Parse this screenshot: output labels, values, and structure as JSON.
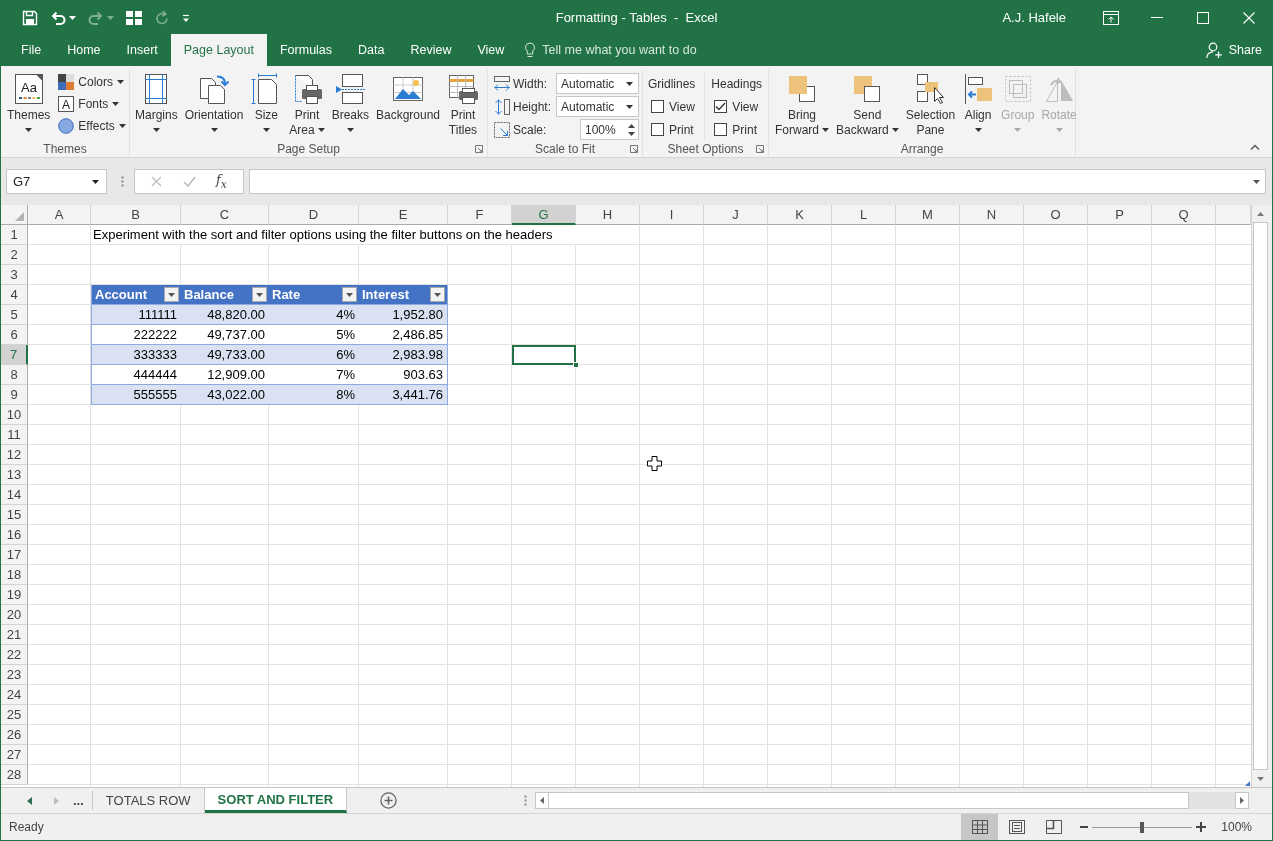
{
  "window": {
    "title": "Formatting - Tables  -  Excel",
    "user": "A.J. Hafele"
  },
  "quick_access": [
    {
      "disabled": false
    },
    {
      "disabled": false
    },
    {
      "disabled": true
    },
    {
      "disabled": false
    },
    {
      "disabled": true
    },
    {
      "disabled": false
    }
  ],
  "tabs": [
    {
      "label": "File",
      "selected": false
    },
    {
      "label": "Home",
      "selected": false
    },
    {
      "label": "Insert",
      "selected": false
    },
    {
      "label": "Page Layout",
      "selected": true
    },
    {
      "label": "Formulas",
      "selected": false
    },
    {
      "label": "Data",
      "selected": false
    },
    {
      "label": "Review",
      "selected": false
    },
    {
      "label": "View",
      "selected": false
    }
  ],
  "tell_me": {
    "placeholder": "Tell me what you want to do"
  },
  "share": "Share",
  "ribbon": [
    {
      "label": "Themes",
      "launcher": false,
      "items": [
        {
          "kind": "large",
          "lines": [
            "Themes"
          ],
          "glyph": "Aa",
          "dropdown": true,
          "disabled": false
        },
        {
          "kind": "stack",
          "buttons": [
            {
              "label": "Colors",
              "dropdown": true
            },
            {
              "label": "Fonts",
              "glyph": "A",
              "dropdown": true
            },
            {
              "label": "Effects",
              "dropdown": true
            }
          ]
        }
      ]
    },
    {
      "label": "Page Setup",
      "launcher": true,
      "items": [
        {
          "kind": "large",
          "lines": [
            "Margins"
          ],
          "dropdown": true,
          "disabled": false
        },
        {
          "kind": "large",
          "lines": [
            "Orientation"
          ],
          "dropdown": true,
          "disabled": false
        },
        {
          "kind": "large",
          "lines": [
            "Size"
          ],
          "dropdown": true,
          "disabled": false
        },
        {
          "kind": "large",
          "lines": [
            "Print",
            "Area"
          ],
          "dropdown": true,
          "disabled": false
        },
        {
          "kind": "large",
          "lines": [
            "Breaks"
          ],
          "dropdown": true,
          "disabled": false
        },
        {
          "kind": "large",
          "lines": [
            "Background"
          ],
          "dropdown": false,
          "disabled": false
        },
        {
          "kind": "large",
          "lines": [
            "Print",
            "Titles"
          ],
          "dropdown": false,
          "disabled": false
        }
      ]
    },
    {
      "label": "Scale to Fit",
      "launcher": true,
      "items": [
        {
          "kind": "fields",
          "rows": [
            {
              "label": "Width:",
              "value": "Automatic",
              "kind": "select"
            },
            {
              "label": "Height:",
              "value": "Automatic",
              "kind": "select"
            },
            {
              "label": "Scale:",
              "value": "100%",
              "kind": "spinner"
            }
          ]
        }
      ]
    },
    {
      "label": "Sheet Options",
      "launcher": true,
      "items": [
        {
          "kind": "checks",
          "label": "Gridlines",
          "options": [
            {
              "label": "View",
              "checked": false
            },
            {
              "label": "Print",
              "checked": false
            }
          ]
        },
        {
          "kind": "checks",
          "label": "Headings",
          "options": [
            {
              "label": "View",
              "checked": true
            },
            {
              "label": "Print",
              "checked": false
            }
          ]
        }
      ]
    },
    {
      "label": "Arrange",
      "launcher": false,
      "items": [
        {
          "kind": "large",
          "lines": [
            "Bring",
            "Forward"
          ],
          "dropdown": true,
          "disabled": false
        },
        {
          "kind": "large",
          "lines": [
            "Send",
            "Backward"
          ],
          "dropdown": true,
          "disabled": false
        },
        {
          "kind": "large",
          "lines": [
            "Selection",
            "Pane"
          ],
          "dropdown": false,
          "disabled": false
        },
        {
          "kind": "large",
          "lines": [
            "Align"
          ],
          "dropdown": true,
          "disabled": false
        },
        {
          "kind": "large",
          "lines": [
            "Group"
          ],
          "dropdown": true,
          "disabled": true
        },
        {
          "kind": "large",
          "lines": [
            "Rotate"
          ],
          "dropdown": true,
          "disabled": true
        }
      ]
    }
  ],
  "formula_bar": {
    "name_box": "G7",
    "insert_function": "f$_{x}$",
    "editing": false
  },
  "sheet": {
    "columns": [
      {
        "label": "A",
        "selected": false
      },
      {
        "label": "B",
        "selected": false
      },
      {
        "label": "C",
        "selected": false
      },
      {
        "label": "D",
        "selected": false
      },
      {
        "label": "E",
        "selected": false
      },
      {
        "label": "F",
        "selected": false
      },
      {
        "label": "G",
        "selected": true
      },
      {
        "label": "H",
        "selected": false
      },
      {
        "label": "I",
        "selected": false
      },
      {
        "label": "J",
        "selected": false
      },
      {
        "label": "K",
        "selected": false
      },
      {
        "label": "L",
        "selected": false
      },
      {
        "label": "M",
        "selected": false
      },
      {
        "label": "N",
        "selected": false
      },
      {
        "label": "O",
        "selected": false
      },
      {
        "label": "P",
        "selected": false
      },
      {
        "label": "Q",
        "selected": false
      }
    ],
    "rows": [
      {
        "label": "1",
        "selected": false
      },
      {
        "label": "2",
        "selected": false
      },
      {
        "label": "3",
        "selected": false
      },
      {
        "label": "4",
        "selected": false
      },
      {
        "label": "5",
        "selected": false
      },
      {
        "label": "6",
        "selected": false
      },
      {
        "label": "7",
        "selected": true
      },
      {
        "label": "8",
        "selected": false
      },
      {
        "label": "9",
        "selected": false
      },
      {
        "label": "10",
        "selected": false
      },
      {
        "label": "11",
        "selected": false
      },
      {
        "label": "12",
        "selected": false
      },
      {
        "label": "13",
        "selected": false
      },
      {
        "label": "14",
        "selected": false
      },
      {
        "label": "15",
        "selected": false
      },
      {
        "label": "16",
        "selected": false
      },
      {
        "label": "17",
        "selected": false
      },
      {
        "label": "18",
        "selected": false
      },
      {
        "label": "19",
        "selected": false
      },
      {
        "label": "20",
        "selected": false
      },
      {
        "label": "21",
        "selected": false
      },
      {
        "label": "22",
        "selected": false
      },
      {
        "label": "23",
        "selected": false
      },
      {
        "label": "24",
        "selected": false
      },
      {
        "label": "25",
        "selected": false
      },
      {
        "label": "26",
        "selected": false
      },
      {
        "label": "27",
        "selected": false
      },
      {
        "label": "28",
        "selected": false
      }
    ],
    "note": "Experiment with the sort and filter options using the filter buttons on the headers",
    "table": {
      "columns": [
        "Account",
        "Balance",
        "Rate",
        "Interest"
      ],
      "rows": [
        [
          "111111",
          "48,820.00",
          "4%",
          "1,952.80"
        ],
        [
          "222222",
          "49,737.00",
          "5%",
          "2,486.85"
        ],
        [
          "333333",
          "49,733.00",
          "6%",
          "2,983.98"
        ],
        [
          "444444",
          "12,909.00",
          "7%",
          "903.63"
        ],
        [
          "555555",
          "43,022.00",
          "8%",
          "3,441.76"
        ]
      ]
    }
  },
  "sheet_tabs": {
    "nav": [
      {
        "disabled": false
      },
      {
        "disabled": true
      }
    ],
    "more": "...",
    "tabs": [
      {
        "label": "TOTALS ROW",
        "selected": false
      },
      {
        "label": "SORT AND FILTER",
        "selected": true
      }
    ]
  },
  "status_bar": {
    "status": "Ready",
    "views": [
      {
        "selected": true
      },
      {
        "selected": false
      },
      {
        "selected": false
      }
    ],
    "zoom": {
      "level": 0.5,
      "reading": "100%"
    }
  }
}
